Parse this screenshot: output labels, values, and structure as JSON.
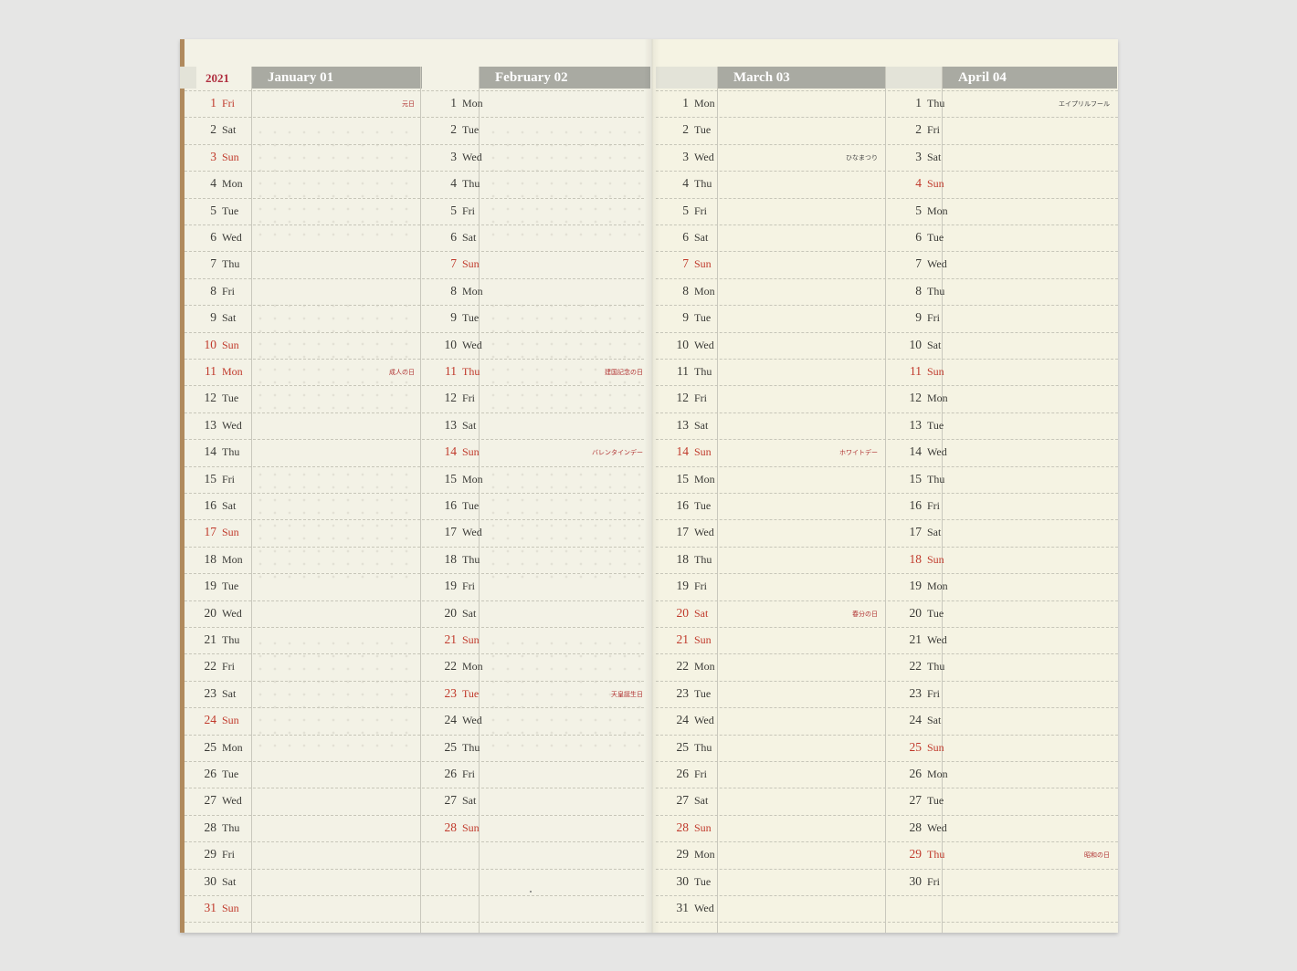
{
  "planner": {
    "year": "2021",
    "colors": {
      "page_left": "#f3f2e6",
      "page_right": "#f5f3e3",
      "header": "#a9aaa2",
      "holiday_red": "#c0392b",
      "kraft": "#b08a5d"
    },
    "months": [
      {
        "title": "January 01",
        "days": [
          {
            "n": "1",
            "wd": "Fri",
            "red": true,
            "note": "元日",
            "note_red": true
          },
          {
            "n": "2",
            "wd": "Sat"
          },
          {
            "n": "3",
            "wd": "Sun",
            "red": true
          },
          {
            "n": "4",
            "wd": "Mon"
          },
          {
            "n": "5",
            "wd": "Tue"
          },
          {
            "n": "6",
            "wd": "Wed"
          },
          {
            "n": "7",
            "wd": "Thu"
          },
          {
            "n": "8",
            "wd": "Fri"
          },
          {
            "n": "9",
            "wd": "Sat"
          },
          {
            "n": "10",
            "wd": "Sun",
            "red": true
          },
          {
            "n": "11",
            "wd": "Mon",
            "red": true,
            "note": "成人の日",
            "note_red": true
          },
          {
            "n": "12",
            "wd": "Tue"
          },
          {
            "n": "13",
            "wd": "Wed"
          },
          {
            "n": "14",
            "wd": "Thu"
          },
          {
            "n": "15",
            "wd": "Fri"
          },
          {
            "n": "16",
            "wd": "Sat"
          },
          {
            "n": "17",
            "wd": "Sun",
            "red": true
          },
          {
            "n": "18",
            "wd": "Mon"
          },
          {
            "n": "19",
            "wd": "Tue"
          },
          {
            "n": "20",
            "wd": "Wed"
          },
          {
            "n": "21",
            "wd": "Thu"
          },
          {
            "n": "22",
            "wd": "Fri"
          },
          {
            "n": "23",
            "wd": "Sat"
          },
          {
            "n": "24",
            "wd": "Sun",
            "red": true
          },
          {
            "n": "25",
            "wd": "Mon"
          },
          {
            "n": "26",
            "wd": "Tue"
          },
          {
            "n": "27",
            "wd": "Wed"
          },
          {
            "n": "28",
            "wd": "Thu"
          },
          {
            "n": "29",
            "wd": "Fri"
          },
          {
            "n": "30",
            "wd": "Sat"
          },
          {
            "n": "31",
            "wd": "Sun",
            "red": true
          }
        ]
      },
      {
        "title": "February 02",
        "days": [
          {
            "n": "1",
            "wd": "Mon"
          },
          {
            "n": "2",
            "wd": "Tue"
          },
          {
            "n": "3",
            "wd": "Wed"
          },
          {
            "n": "4",
            "wd": "Thu"
          },
          {
            "n": "5",
            "wd": "Fri"
          },
          {
            "n": "6",
            "wd": "Sat"
          },
          {
            "n": "7",
            "wd": "Sun",
            "red": true
          },
          {
            "n": "8",
            "wd": "Mon"
          },
          {
            "n": "9",
            "wd": "Tue"
          },
          {
            "n": "10",
            "wd": "Wed"
          },
          {
            "n": "11",
            "wd": "Thu",
            "red": true,
            "note": "建国記念の日",
            "note_red": true
          },
          {
            "n": "12",
            "wd": "Fri"
          },
          {
            "n": "13",
            "wd": "Sat"
          },
          {
            "n": "14",
            "wd": "Sun",
            "red": true,
            "note": "バレンタインデー",
            "note_red": true
          },
          {
            "n": "15",
            "wd": "Mon"
          },
          {
            "n": "16",
            "wd": "Tue"
          },
          {
            "n": "17",
            "wd": "Wed"
          },
          {
            "n": "18",
            "wd": "Thu"
          },
          {
            "n": "19",
            "wd": "Fri"
          },
          {
            "n": "20",
            "wd": "Sat"
          },
          {
            "n": "21",
            "wd": "Sun",
            "red": true
          },
          {
            "n": "22",
            "wd": "Mon"
          },
          {
            "n": "23",
            "wd": "Tue",
            "red": true,
            "note": "天皇誕生日",
            "note_red": true
          },
          {
            "n": "24",
            "wd": "Wed"
          },
          {
            "n": "25",
            "wd": "Thu"
          },
          {
            "n": "26",
            "wd": "Fri"
          },
          {
            "n": "27",
            "wd": "Sat"
          },
          {
            "n": "28",
            "wd": "Sun",
            "red": true
          }
        ]
      },
      {
        "title": "March 03",
        "days": [
          {
            "n": "1",
            "wd": "Mon"
          },
          {
            "n": "2",
            "wd": "Tue"
          },
          {
            "n": "3",
            "wd": "Wed",
            "note": "ひなまつり"
          },
          {
            "n": "4",
            "wd": "Thu"
          },
          {
            "n": "5",
            "wd": "Fri"
          },
          {
            "n": "6",
            "wd": "Sat"
          },
          {
            "n": "7",
            "wd": "Sun",
            "red": true
          },
          {
            "n": "8",
            "wd": "Mon"
          },
          {
            "n": "9",
            "wd": "Tue"
          },
          {
            "n": "10",
            "wd": "Wed"
          },
          {
            "n": "11",
            "wd": "Thu"
          },
          {
            "n": "12",
            "wd": "Fri"
          },
          {
            "n": "13",
            "wd": "Sat"
          },
          {
            "n": "14",
            "wd": "Sun",
            "red": true,
            "note": "ホワイトデー",
            "note_red": true
          },
          {
            "n": "15",
            "wd": "Mon"
          },
          {
            "n": "16",
            "wd": "Tue"
          },
          {
            "n": "17",
            "wd": "Wed"
          },
          {
            "n": "18",
            "wd": "Thu"
          },
          {
            "n": "19",
            "wd": "Fri"
          },
          {
            "n": "20",
            "wd": "Sat",
            "red": true,
            "note": "春分の日",
            "note_red": true
          },
          {
            "n": "21",
            "wd": "Sun",
            "red": true
          },
          {
            "n": "22",
            "wd": "Mon"
          },
          {
            "n": "23",
            "wd": "Tue"
          },
          {
            "n": "24",
            "wd": "Wed"
          },
          {
            "n": "25",
            "wd": "Thu"
          },
          {
            "n": "26",
            "wd": "Fri"
          },
          {
            "n": "27",
            "wd": "Sat"
          },
          {
            "n": "28",
            "wd": "Sun",
            "red": true
          },
          {
            "n": "29",
            "wd": "Mon"
          },
          {
            "n": "30",
            "wd": "Tue"
          },
          {
            "n": "31",
            "wd": "Wed"
          }
        ]
      },
      {
        "title": "April 04",
        "days": [
          {
            "n": "1",
            "wd": "Thu",
            "note": "エイプリルフール"
          },
          {
            "n": "2",
            "wd": "Fri"
          },
          {
            "n": "3",
            "wd": "Sat"
          },
          {
            "n": "4",
            "wd": "Sun",
            "red": true
          },
          {
            "n": "5",
            "wd": "Mon"
          },
          {
            "n": "6",
            "wd": "Tue"
          },
          {
            "n": "7",
            "wd": "Wed"
          },
          {
            "n": "8",
            "wd": "Thu"
          },
          {
            "n": "9",
            "wd": "Fri"
          },
          {
            "n": "10",
            "wd": "Sat"
          },
          {
            "n": "11",
            "wd": "Sun",
            "red": true
          },
          {
            "n": "12",
            "wd": "Mon"
          },
          {
            "n": "13",
            "wd": "Tue"
          },
          {
            "n": "14",
            "wd": "Wed"
          },
          {
            "n": "15",
            "wd": "Thu"
          },
          {
            "n": "16",
            "wd": "Fri"
          },
          {
            "n": "17",
            "wd": "Sat"
          },
          {
            "n": "18",
            "wd": "Sun",
            "red": true
          },
          {
            "n": "19",
            "wd": "Mon"
          },
          {
            "n": "20",
            "wd": "Tue"
          },
          {
            "n": "21",
            "wd": "Wed"
          },
          {
            "n": "22",
            "wd": "Thu"
          },
          {
            "n": "23",
            "wd": "Fri"
          },
          {
            "n": "24",
            "wd": "Sat"
          },
          {
            "n": "25",
            "wd": "Sun",
            "red": true
          },
          {
            "n": "26",
            "wd": "Mon"
          },
          {
            "n": "27",
            "wd": "Tue"
          },
          {
            "n": "28",
            "wd": "Wed"
          },
          {
            "n": "29",
            "wd": "Thu",
            "red": true,
            "note": "昭和の日",
            "note_red": true
          },
          {
            "n": "30",
            "wd": "Fri"
          }
        ]
      }
    ]
  }
}
